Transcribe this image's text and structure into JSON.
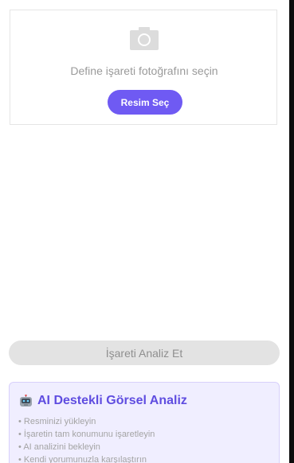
{
  "upload": {
    "prompt": "Define işareti fotoğrafını seçin",
    "button_label": "Resim Seç",
    "icon": "camera-icon"
  },
  "analyze": {
    "button_label": "İşareti Analiz Et"
  },
  "info": {
    "icon": "robot-icon",
    "title": "AI Destekli Görsel Analiz",
    "steps": [
      "Resminizi yükleyin",
      "İşaretin tam konumunu işaretleyin",
      "AI analizini bekleyin",
      "Kendi yorumunuzla karşılaştırın"
    ]
  },
  "colors": {
    "accent": "#6f5af3",
    "title": "#5f4de0",
    "info_bg": "#f0eeff",
    "disabled_bg": "#e3e3e3"
  }
}
